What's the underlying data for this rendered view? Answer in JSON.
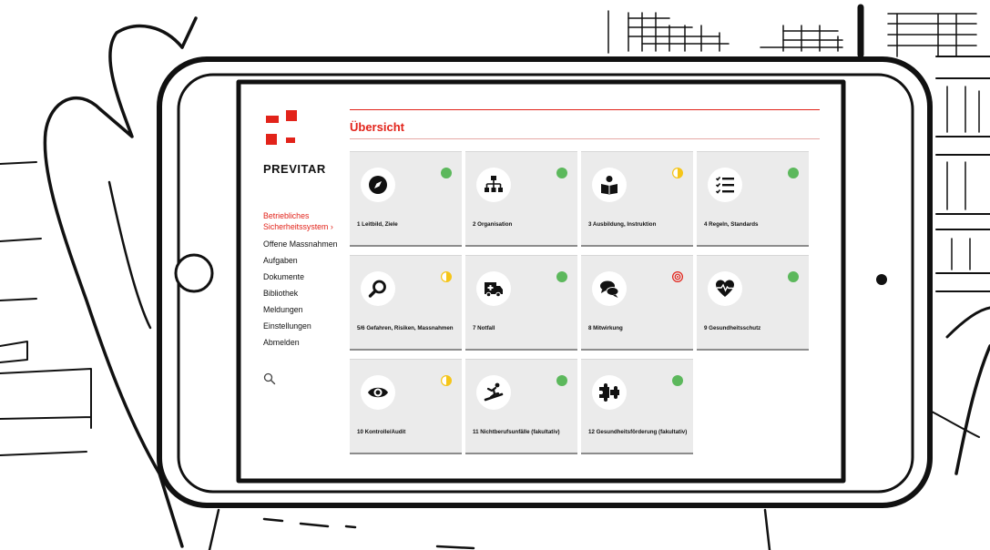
{
  "app": {
    "brand": "PREVITAR",
    "page_title": "Übersicht",
    "accent_color": "#e2231a",
    "status_colors": {
      "green": "#5cb85c",
      "yellow": "#f5c518",
      "red": "#e2231a"
    }
  },
  "sidebar": {
    "items": [
      {
        "label": "Betriebliches Sicherheitssystem ›",
        "active": true
      },
      {
        "label": "Offene Massnahmen"
      },
      {
        "label": "Aufgaben"
      },
      {
        "label": "Dokumente"
      },
      {
        "label": "Bibliothek"
      },
      {
        "label": "Meldungen"
      },
      {
        "label": "Einstellungen"
      },
      {
        "label": "Abmelden"
      }
    ],
    "search_icon": "search-icon"
  },
  "tiles": [
    {
      "label": "1 Leitbild, Ziele",
      "icon": "compass-icon",
      "status": "green"
    },
    {
      "label": "2 Organisation",
      "icon": "org-chart-icon",
      "status": "green"
    },
    {
      "label": "3 Ausbildung, Instruktion",
      "icon": "reader-icon",
      "status": "yellow-half"
    },
    {
      "label": "4 Regeln, Standards",
      "icon": "checklist-icon",
      "status": "green"
    },
    {
      "label": "5/6 Gefahren, Risiken, Massnahmen",
      "icon": "magnifier-icon",
      "status": "yellow-half"
    },
    {
      "label": "7 Notfall",
      "icon": "ambulance-icon",
      "status": "green"
    },
    {
      "label": "8 Mitwirkung",
      "icon": "chat-bubbles-icon",
      "status": "red-target"
    },
    {
      "label": "9 Gesundheitsschutz",
      "icon": "heartbeat-icon",
      "status": "green"
    },
    {
      "label": "10 Kontrolle/Audit",
      "icon": "eye-icon",
      "status": "yellow-half"
    },
    {
      "label": "11 Nichtberufsunfälle (fakultativ)",
      "icon": "snowboarder-icon",
      "status": "green"
    },
    {
      "label": "12 Gesundheitsförderung (fakultativ)",
      "icon": "puzzle-icon",
      "status": "green"
    }
  ]
}
